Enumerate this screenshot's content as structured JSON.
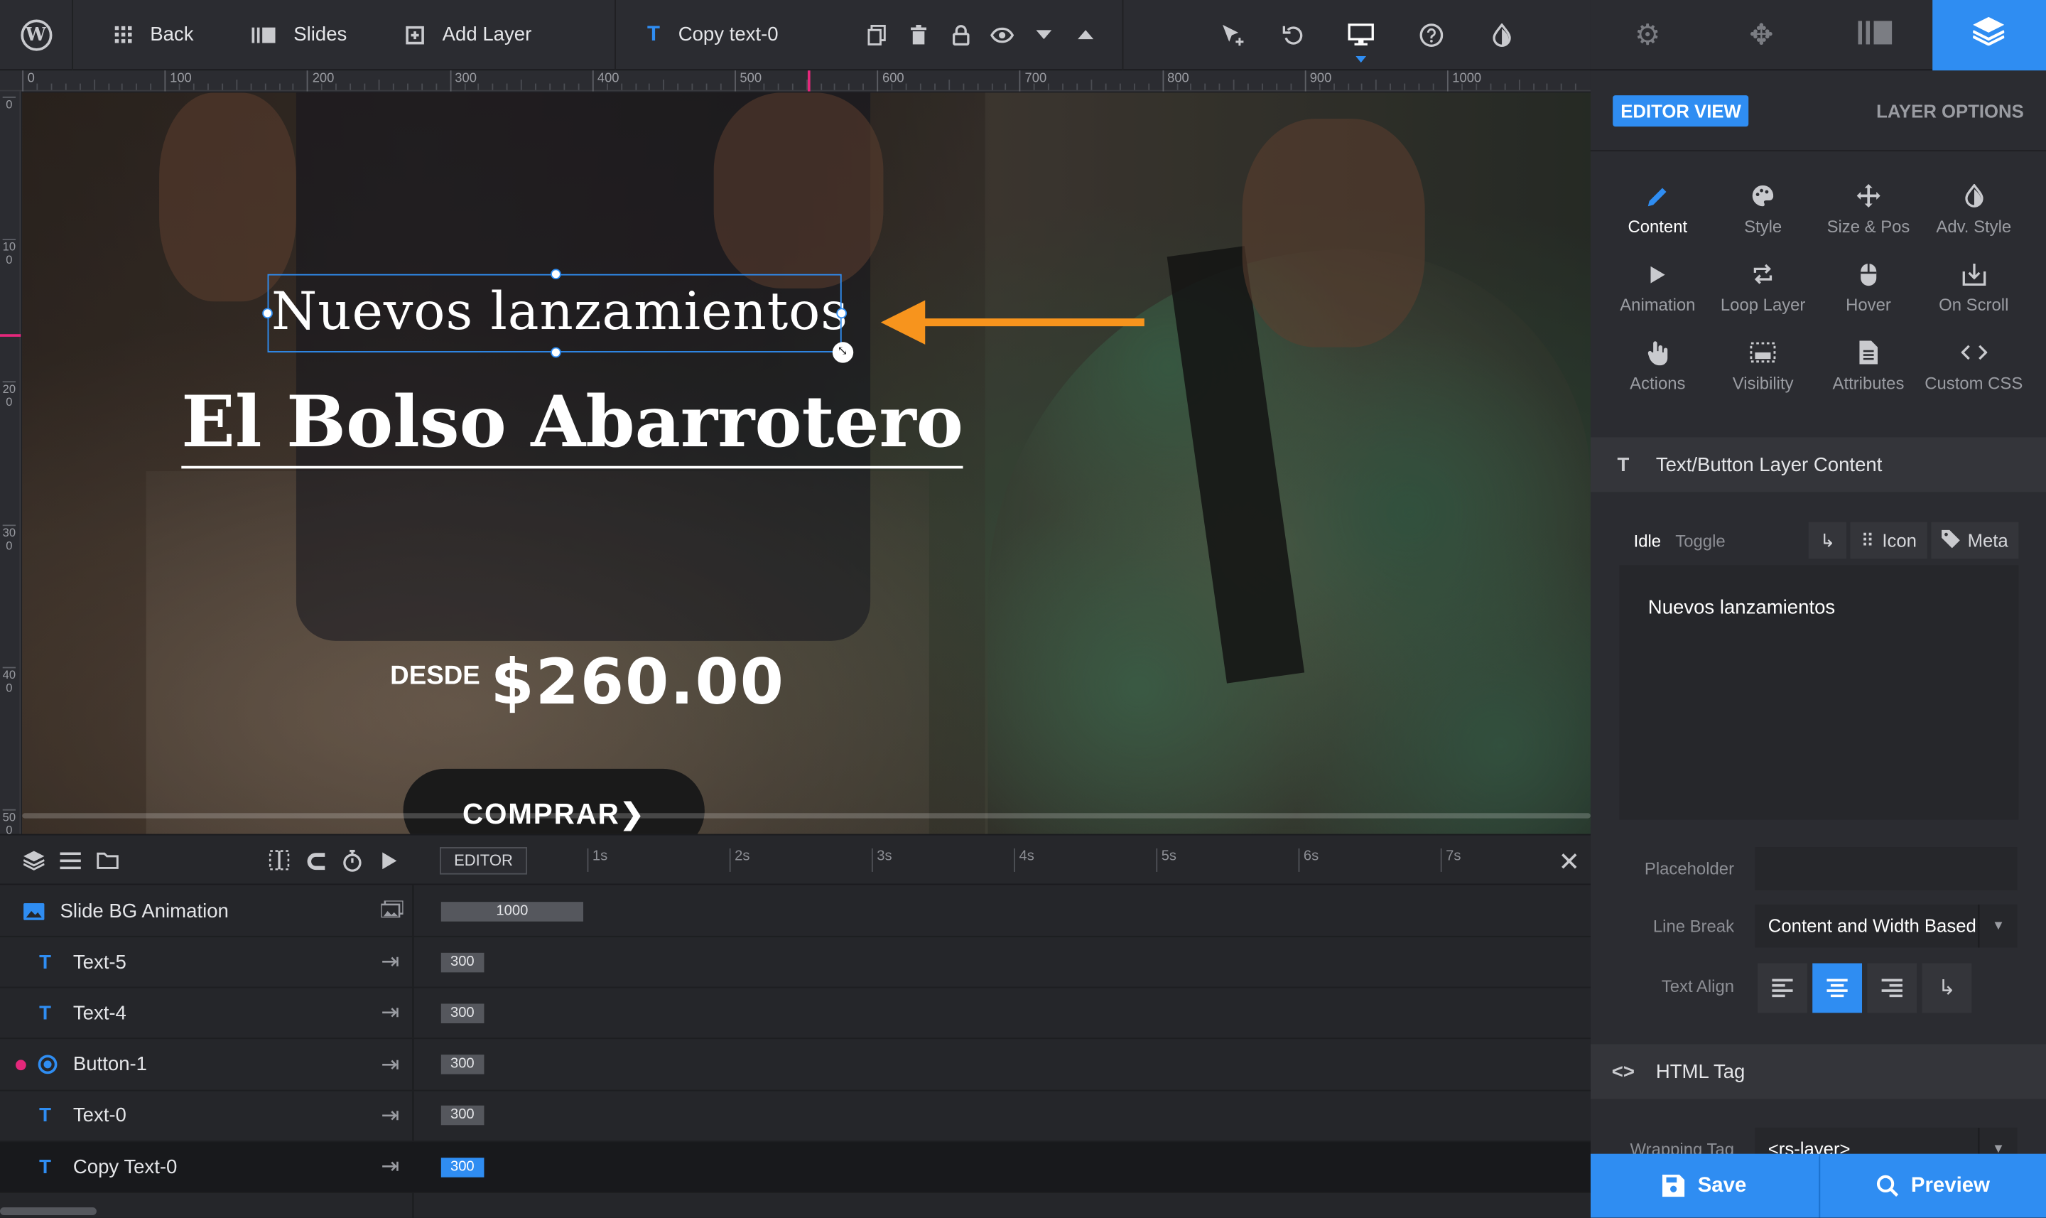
{
  "toolbar": {
    "back_label": "Back",
    "slides_label": "Slides",
    "add_layer_label": "Add Layer",
    "current_layer_label": "Copy text-0"
  },
  "ruler": {
    "horizontal_ticks": [
      "0",
      "100",
      "200",
      "300",
      "400",
      "500",
      "600",
      "700",
      "800",
      "900",
      "1000"
    ],
    "vertical_ticks": [
      "0",
      "100",
      "200",
      "300",
      "400",
      "500"
    ]
  },
  "canvas": {
    "title_text": "Nuevos lanzamientos",
    "heading_text": "El Bolso Abarrotero",
    "price_prefix": "DESDE",
    "price_value": "$260.00",
    "button_text": "COMPRAR"
  },
  "timeline": {
    "editor_tag": "EDITOR",
    "seconds": [
      "1s",
      "2s",
      "3s",
      "4s",
      "5s",
      "6s",
      "7s"
    ],
    "rows": [
      {
        "name": "Slide BG Animation",
        "duration": "1000",
        "type": "bg"
      },
      {
        "name": "Text-5",
        "duration": "300",
        "type": "text"
      },
      {
        "name": "Text-4",
        "duration": "300",
        "type": "text"
      },
      {
        "name": "Button-1",
        "duration": "300",
        "type": "button"
      },
      {
        "name": "Text-0",
        "duration": "300",
        "type": "text"
      },
      {
        "name": "Copy Text-0",
        "duration": "300",
        "type": "text",
        "selected": true
      }
    ]
  },
  "right_panel": {
    "editor_view_label": "EDITOR VIEW",
    "layer_options_label": "LAYER OPTIONS",
    "tools": [
      {
        "label": "Content",
        "icon": "pencil-icon",
        "active": true
      },
      {
        "label": "Style",
        "icon": "palette-icon"
      },
      {
        "label": "Size & Pos",
        "icon": "move-icon"
      },
      {
        "label": "Adv. Style",
        "icon": "contrast-icon"
      },
      {
        "label": "Animation",
        "icon": "play-icon"
      },
      {
        "label": "Loop Layer",
        "icon": "loop-icon"
      },
      {
        "label": "Hover",
        "icon": "mouse-icon"
      },
      {
        "label": "On Scroll",
        "icon": "scroll-icon"
      },
      {
        "label": "Actions",
        "icon": "hand-icon"
      },
      {
        "label": "Visibility",
        "icon": "visibility-icon"
      },
      {
        "label": "Attributes",
        "icon": "document-icon"
      },
      {
        "label": "Custom CSS",
        "icon": "code-icon"
      }
    ],
    "content_section_title": "Text/Button Layer Content",
    "state_idle": "Idle",
    "state_toggle": "Toggle",
    "icon_button_label": "Icon",
    "meta_button_label": "Meta",
    "content_text": "Nuevos lanzamientos",
    "placeholder_label": "Placeholder",
    "placeholder_value": "",
    "line_break_label": "Line Break",
    "line_break_value": "Content and Width Based",
    "text_align_label": "Text Align",
    "html_tag_section_title": "HTML Tag",
    "wrapping_tag_label": "Wrapping Tag",
    "wrapping_tag_value": "<rs-layer>",
    "save_label": "Save",
    "preview_label": "Preview"
  },
  "colors": {
    "accent": "#2f8df2",
    "arrow": "#f7941d",
    "marker": "#e4287b"
  }
}
